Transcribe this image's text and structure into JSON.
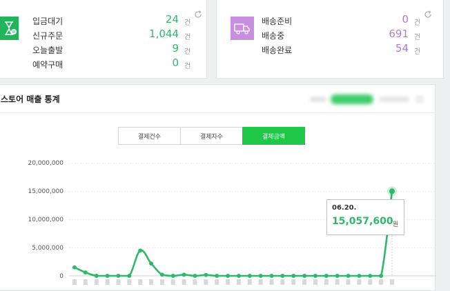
{
  "left_summary": {
    "items": [
      {
        "label": "입금대기",
        "value": "24",
        "unit": "건"
      },
      {
        "label": "신규주문",
        "value": "1,044",
        "unit": "건"
      },
      {
        "label": "오늘출발",
        "value": "9",
        "unit": "건"
      },
      {
        "label": "예약구매",
        "value": "0",
        "unit": "건"
      }
    ],
    "icon": "hourglass-icon"
  },
  "right_summary": {
    "items": [
      {
        "label": "배송준비",
        "value": "0",
        "unit": "건"
      },
      {
        "label": "배송중",
        "value": "691",
        "unit": "건"
      },
      {
        "label": "배송완료",
        "value": "54",
        "unit": "건"
      }
    ],
    "icon": "truck-icon"
  },
  "sales_panel": {
    "title": "스토어 매출 통계",
    "tabs": [
      {
        "label": "결제건수",
        "active": false
      },
      {
        "label": "결제자수",
        "active": false
      },
      {
        "label": "결제금액",
        "active": true
      }
    ]
  },
  "colors": {
    "green_accent": "#1ec748",
    "green_value": "#2fb86a",
    "purple_value": "#b47ad2",
    "purple_icon": "#c88ee0"
  },
  "chart_data": {
    "type": "line",
    "y_ticks": [
      "20,000,000",
      "15,000,000",
      "10,000,000",
      "5,000,000",
      "0"
    ],
    "ylim": [
      0,
      20000000
    ],
    "grid": true,
    "series": [
      {
        "values": [
          1500000,
          600000,
          0,
          0,
          0,
          0,
          4500000,
          2200000,
          200000,
          0,
          200000,
          0,
          150000,
          0,
          0,
          0,
          0,
          0,
          0,
          0,
          0,
          0,
          0,
          0,
          0,
          0,
          0,
          0,
          0,
          15057600
        ]
      }
    ],
    "tooltip": {
      "date": "06.20.",
      "value": "15,057,600",
      "unit": "원"
    }
  }
}
